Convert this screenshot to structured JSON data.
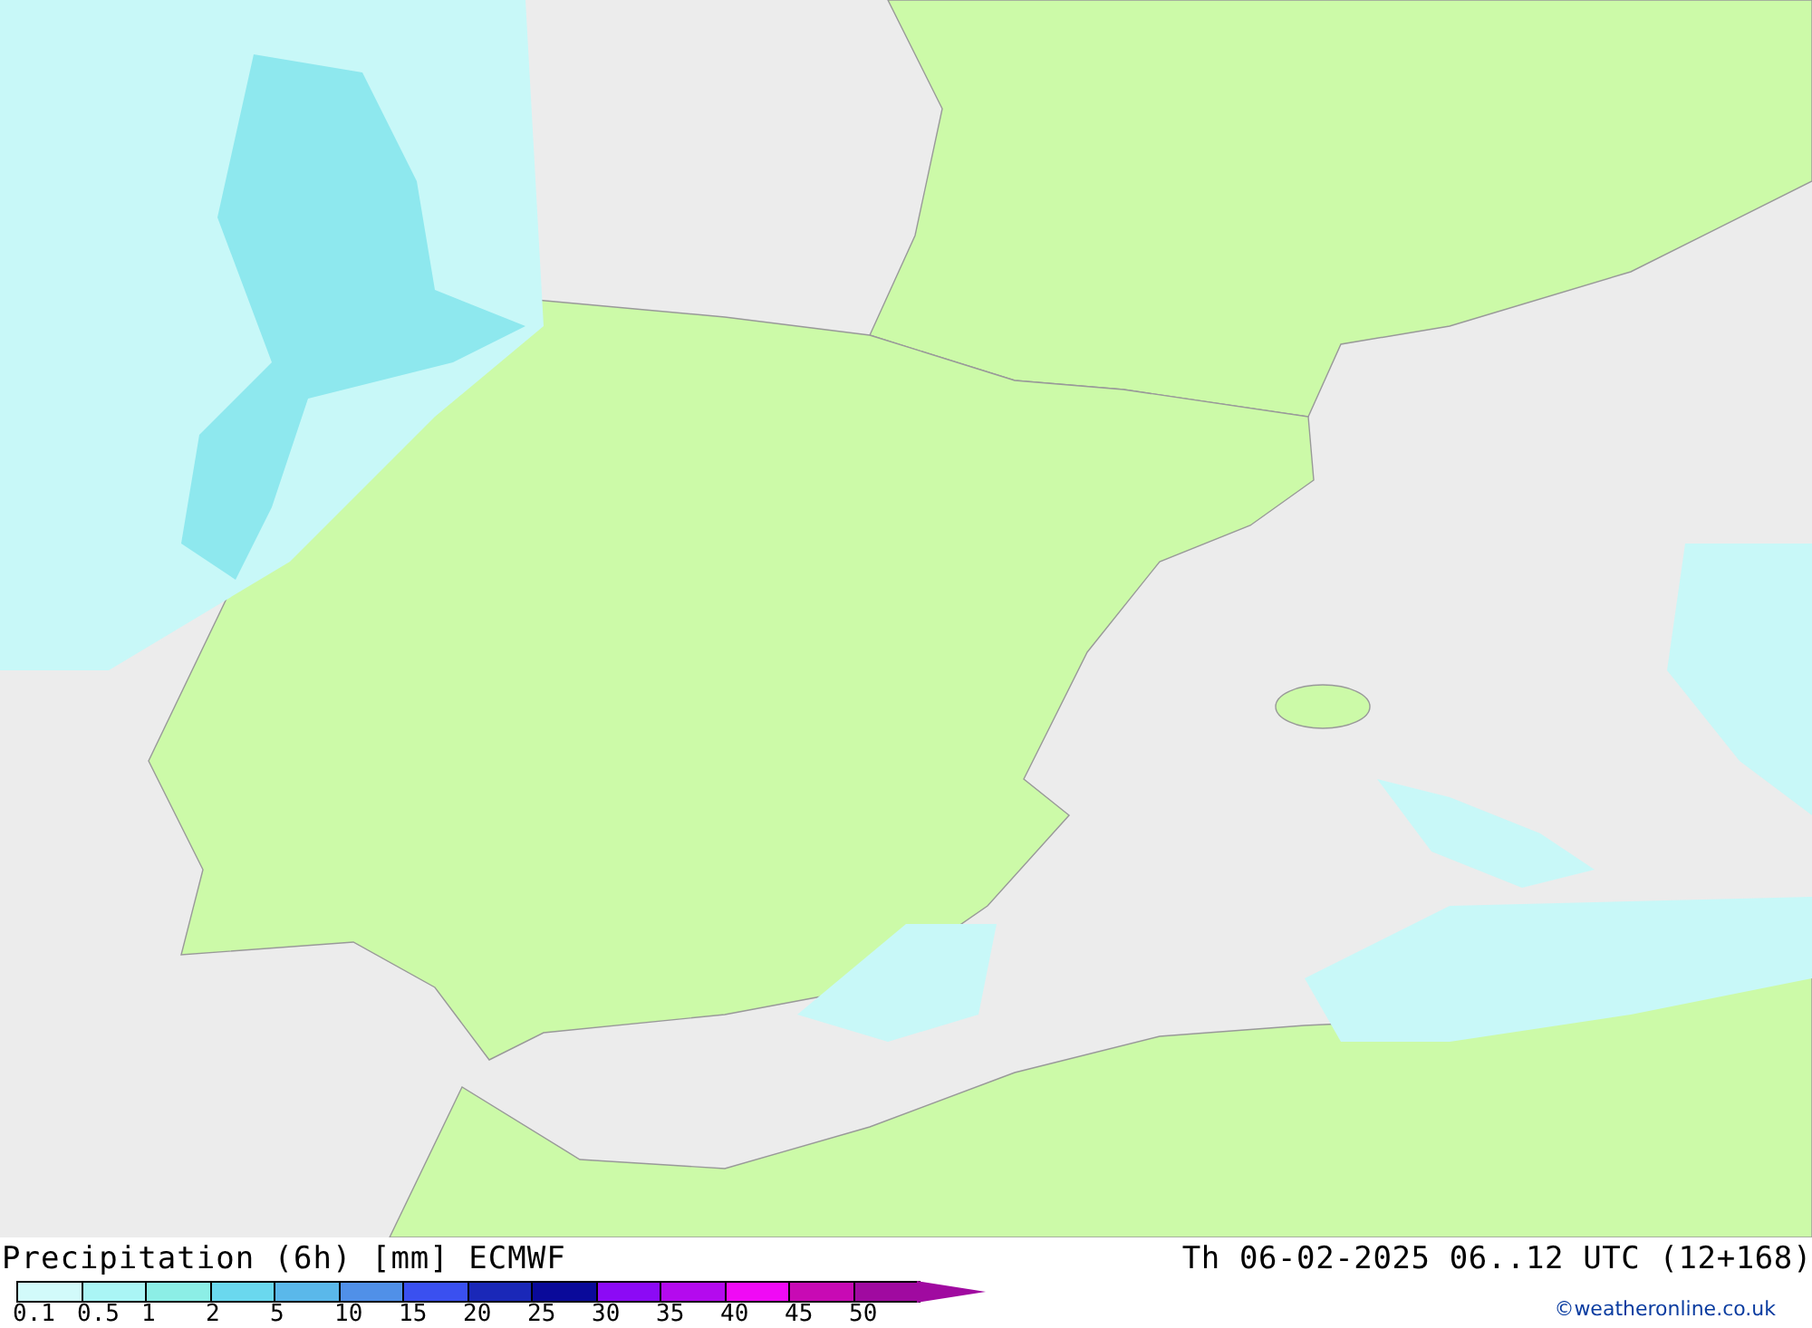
{
  "title": "Precipitation (6h) [mm] ECMWF",
  "valid_time": "Th 06-02-2025 06..12 UTC (12+168)",
  "legend": [
    {
      "label": "0.1",
      "color": "#d2fafa"
    },
    {
      "label": "0.5",
      "color": "#aaf5f5"
    },
    {
      "label": "1",
      "color": "#8ceee6"
    },
    {
      "label": "2",
      "color": "#6ad8ee"
    },
    {
      "label": "5",
      "color": "#5ab8ea"
    },
    {
      "label": "10",
      "color": "#5090e8"
    },
    {
      "label": "15",
      "color": "#3a50f0"
    },
    {
      "label": "20",
      "color": "#1a28b8"
    },
    {
      "label": "25",
      "color": "#0a0a9a"
    },
    {
      "label": "30",
      "color": "#8c0af5"
    },
    {
      "label": "35",
      "color": "#b40aee"
    },
    {
      "label": "40",
      "color": "#f00af5"
    },
    {
      "label": "45",
      "color": "#c80ab4"
    },
    {
      "label": "50",
      "color": "#a00aa0"
    }
  ],
  "credit": "©weatheronline.co.uk"
}
